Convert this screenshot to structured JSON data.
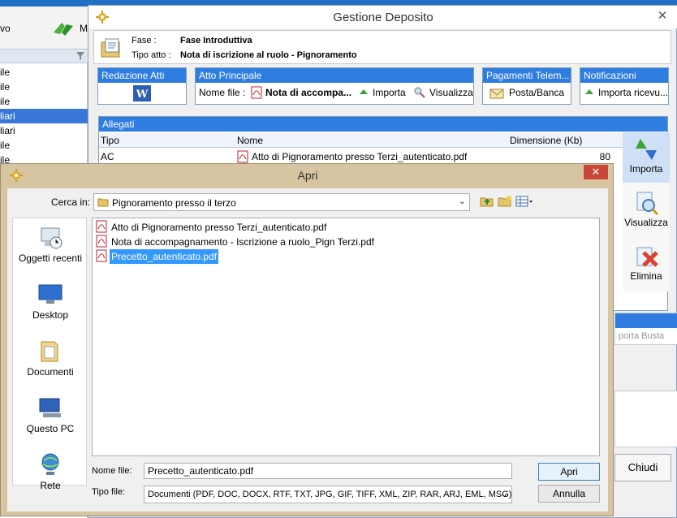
{
  "background_app": {
    "tool_label": "vo",
    "tool_m": "M",
    "rows": [
      {
        "text": "ile",
        "selected": false
      },
      {
        "text": "ile",
        "selected": false
      },
      {
        "text": "ile",
        "selected": false
      },
      {
        "text": "liari",
        "selected": true
      },
      {
        "text": "liari",
        "selected": false
      },
      {
        "text": "ile",
        "selected": false
      },
      {
        "text": "ile",
        "selected": false
      }
    ]
  },
  "gestione": {
    "title": "Gestione Deposito",
    "close": "✕",
    "fase_label": "Fase :",
    "fase_value": "Fase Introduttiva",
    "tipo_label": "Tipo atto :",
    "tipo_value": "Nota di iscrizione al ruolo - Pignoramento",
    "groups": {
      "redazione": "Redazione Atti",
      "atto_principale": "Atto Principale",
      "nome_file_label": "Nome file :",
      "nome_file_value": "Nota di accompa...",
      "importa": "Importa",
      "visualizza": "Visualizza",
      "pagamenti": "Pagamenti Telem...",
      "posta_banca": "Posta/Banca",
      "notificazioni": "Notificazioni",
      "importa_ricevute": "Importa ricevu..."
    },
    "allegati": {
      "title": "Allegati",
      "columns": [
        "Tipo",
        "Nome",
        "Dimensione (Kb)"
      ],
      "rows": [
        {
          "tipo": "AC",
          "nome": "Atto di Pignoramento presso Terzi_autenticato.pdf",
          "dim": "80"
        }
      ]
    },
    "side_buttons": {
      "importa": "Importa",
      "visualizza": "Visualizza",
      "elimina": "Elimina"
    },
    "importa_busta": "porta Busta",
    "chiudi": "Chiudi"
  },
  "apri": {
    "title": "Apri",
    "close": "✕",
    "lookin_label": "Cerca in:",
    "lookin_value": "Pignoramento presso il terzo",
    "places": [
      "Oggetti recenti",
      "Desktop",
      "Documenti",
      "Questo PC",
      "Rete"
    ],
    "files": [
      {
        "name": "Atto di Pignoramento presso Terzi_autenticato.pdf",
        "selected": false
      },
      {
        "name": "Nota di accompagnamento - Iscrizione a ruolo_Pign Terzi.pdf",
        "selected": false
      },
      {
        "name": "Precetto_autenticato.pdf",
        "selected": true
      }
    ],
    "filename_label": "Nome file:",
    "filename_value": "Precetto_autenticato.pdf",
    "filetype_label": "Tipo file:",
    "filetype_value": "Documenti (PDF, DOC, DOCX, RTF, TXT, JPG, GIF, TIFF, XML, ZIP, RAR, ARJ, EML, MSG)",
    "open_button": "Apri",
    "cancel_button": "Annulla"
  }
}
